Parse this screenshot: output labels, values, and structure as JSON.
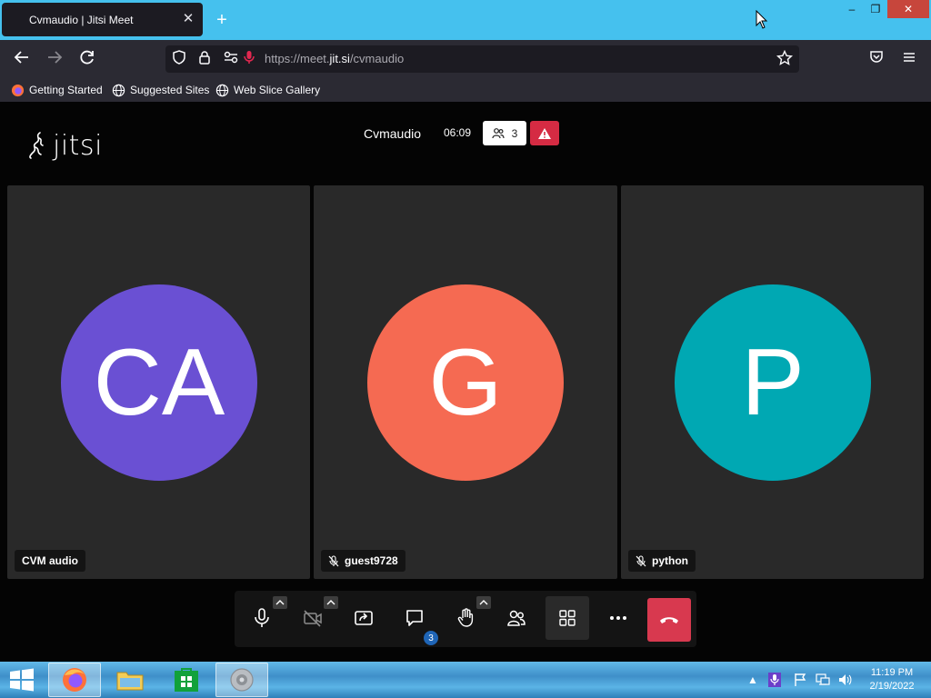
{
  "browser": {
    "tab_title": "Cvmaudio | Jitsi Meet",
    "url_prefix": "https://meet.",
    "url_domain": "jit.si",
    "url_path": "/cvmaudio",
    "bookmarks": [
      {
        "label": "Getting Started",
        "icon": "firefox-icon"
      },
      {
        "label": "Suggested Sites",
        "icon": "globe-icon"
      },
      {
        "label": "Web Slice Gallery",
        "icon": "globe-icon"
      }
    ]
  },
  "meeting": {
    "logo_text": "jitsi",
    "name": "Cvmaudio",
    "timer": "06:09",
    "participant_count": "3"
  },
  "participants": [
    {
      "initials": "CA",
      "name": "CVM audio",
      "color": "#6a50d3",
      "muted": false
    },
    {
      "initials": "G",
      "name": "guest9728",
      "color": "#f56a52",
      "muted": true
    },
    {
      "initials": "P",
      "name": "python",
      "color": "#00a8b3",
      "muted": true
    }
  ],
  "toolbar": {
    "chat_badge": "3"
  },
  "taskbar": {
    "time": "11:19 PM",
    "date": "2/19/2022"
  }
}
